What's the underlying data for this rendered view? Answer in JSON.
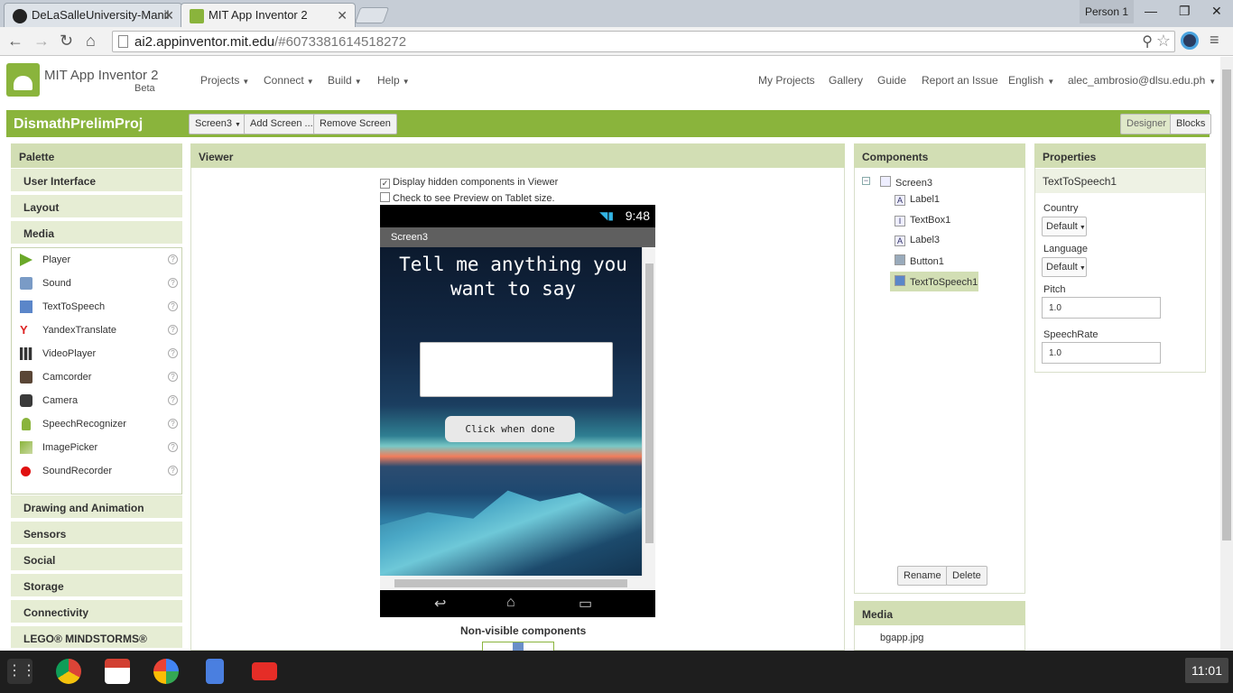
{
  "browser": {
    "tabs": [
      {
        "label": "DeLaSalleUniversity-Manil"
      },
      {
        "label": "MIT App Inventor 2"
      }
    ],
    "person": "Person 1",
    "url_host": "ai2.appinventor.mit.edu",
    "url_path": "/#6073381614518272"
  },
  "header": {
    "brand": "MIT App Inventor 2",
    "beta": "Beta",
    "menus": [
      "Projects",
      "Connect",
      "Build",
      "Help"
    ],
    "links": [
      "My Projects",
      "Gallery",
      "Guide",
      "Report an Issue",
      "English",
      "alec_ambrosio@dlsu.edu.ph"
    ]
  },
  "toolbar": {
    "project": "DismathPrelimProj",
    "screen_select": "Screen3",
    "add_screen": "Add Screen ...",
    "remove_screen": "Remove Screen",
    "designer": "Designer",
    "blocks": "Blocks"
  },
  "palette": {
    "title": "Palette",
    "categories_top": [
      "User Interface",
      "Layout",
      "Media"
    ],
    "media_items": [
      "Player",
      "Sound",
      "TextToSpeech",
      "YandexTranslate",
      "VideoPlayer",
      "Camcorder",
      "Camera",
      "SpeechRecognizer",
      "ImagePicker",
      "SoundRecorder"
    ],
    "categories_bottom": [
      "Drawing and Animation",
      "Sensors",
      "Social",
      "Storage",
      "Connectivity",
      "LEGO® MINDSTORMS®"
    ],
    "help": "?"
  },
  "viewer": {
    "title": "Viewer",
    "check_hidden": "Display hidden components in Viewer",
    "check_tablet": "Check to see Preview on Tablet size.",
    "time": "9:48",
    "screen_title": "Screen3",
    "app_label": "Tell me anything you want to say",
    "app_button": "Click when done",
    "non_visible": "Non-visible components"
  },
  "components": {
    "title": "Components",
    "root": "Screen3",
    "items": [
      "Label1",
      "TextBox1",
      "Label3",
      "Button1",
      "TextToSpeech1"
    ],
    "rename": "Rename",
    "delete": "Delete"
  },
  "media": {
    "title": "Media",
    "files": [
      "bgapp.jpg"
    ]
  },
  "properties": {
    "title": "Properties",
    "component": "TextToSpeech1",
    "country_label": "Country",
    "country_value": "Default",
    "language_label": "Language",
    "language_value": "Default",
    "pitch_label": "Pitch",
    "pitch_value": "1.0",
    "rate_label": "SpeechRate",
    "rate_value": "1.0"
  },
  "taskbar": {
    "clock": "11:01"
  },
  "colors": {
    "accent_green": "#8ab43c",
    "panel_header": "#d2deb4"
  }
}
